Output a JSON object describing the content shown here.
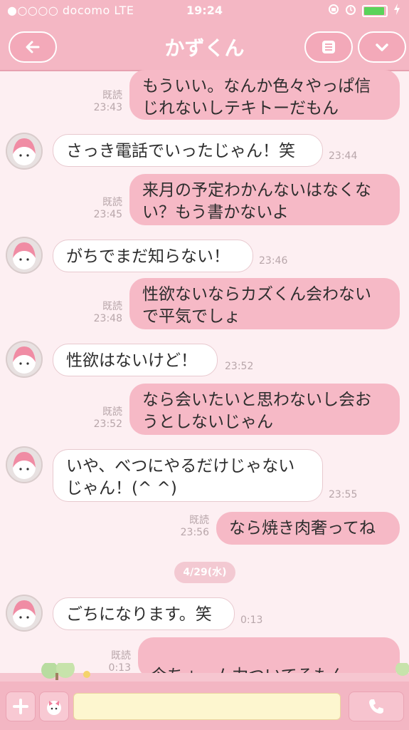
{
  "status": {
    "carrier": "●○○○○ docomo  LTE",
    "time": "19:24"
  },
  "header": {
    "title": "かずくん"
  },
  "read_label": "既読",
  "messages": [
    {
      "side": "out",
      "text": "もういい。なんか色々やっぱ信じれないしテキトーだもん",
      "time": "23:43",
      "read": true
    },
    {
      "side": "in",
      "text": "さっき電話でいったじゃん！笑",
      "time": "23:44"
    },
    {
      "side": "out",
      "text": "来月の予定わかんないはなくない？もう書かないよ",
      "time": "23:45",
      "read": true
    },
    {
      "side": "in",
      "text": "がちでまだ知らない！",
      "time": "23:46"
    },
    {
      "side": "out",
      "text": "性欲ないならカズくん会わないで平気でしょ",
      "time": "23:48",
      "read": true
    },
    {
      "side": "in",
      "text": "性欲はないけど！",
      "time": "23:52"
    },
    {
      "side": "out",
      "text": "なら会いたいと思わないし会おうとしないじゃん",
      "time": "23:52",
      "read": true
    },
    {
      "side": "in",
      "text": "いや、べつにやるだけじゃないじゃん！(^ ^)",
      "time": "23:55"
    },
    {
      "side": "out",
      "text": "なら焼き肉奢ってね",
      "time": "23:56",
      "read": true
    },
    {
      "side": "in",
      "text": "ごちになります。笑",
      "time": "0:13"
    },
    {
      "side": "out",
      "text": "今ちょーム力ついてるもん",
      "time": "0:13",
      "read": true
    }
  ],
  "date_divider": "4/29(水)",
  "colors": {
    "header": "#f4b7c4",
    "background": "#fdeff2",
    "outgoing_bubble": "#f6b9c6",
    "incoming_bubble": "#ffffff",
    "input_field": "#fdf6cf"
  },
  "icons": [
    "back-arrow-icon",
    "menu-icon",
    "chevron-down-icon",
    "plus-icon",
    "sticker-icon",
    "phone-icon",
    "avatar-icon",
    "emoji-face-icon"
  ]
}
